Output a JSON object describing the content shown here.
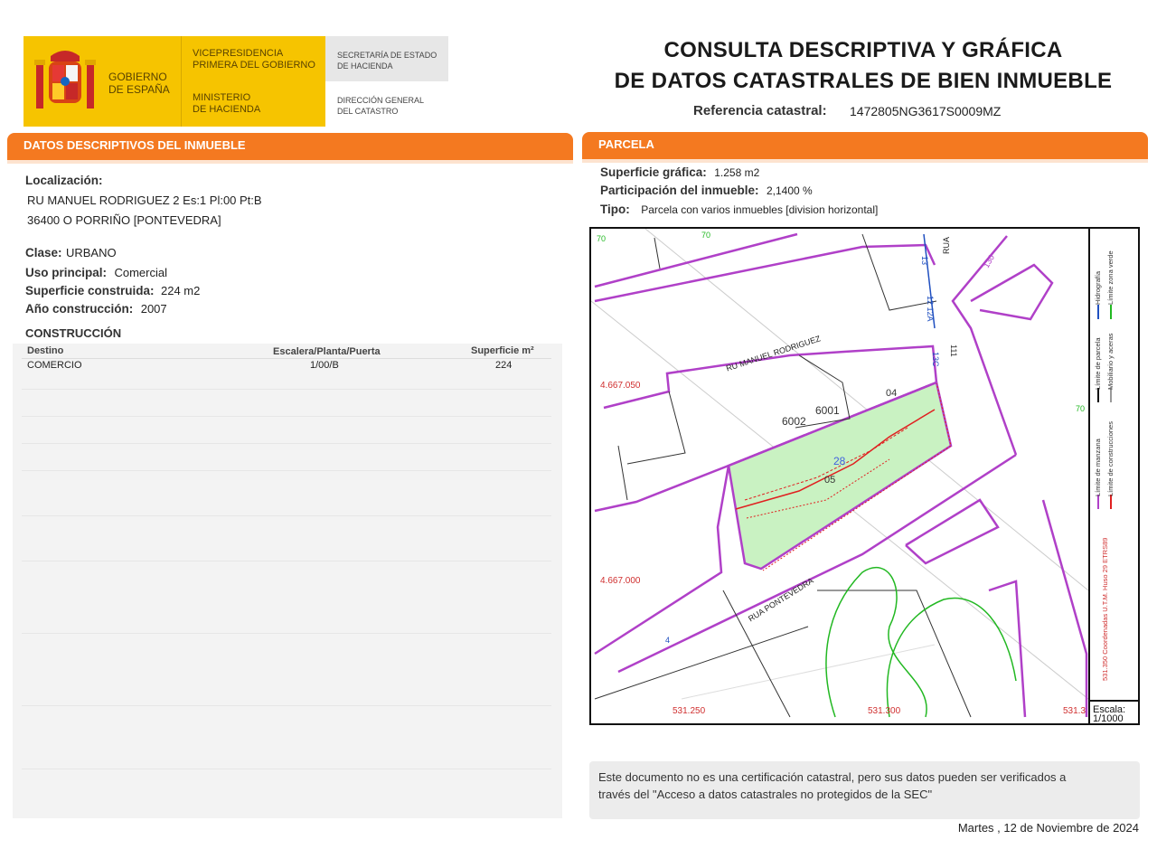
{
  "header": {
    "gobierno": [
      "GOBIERNO",
      "DE ESPAÑA"
    ],
    "vicepresidencia": [
      "VICEPRESIDENCIA",
      "PRIMERA DEL GOBIERNO"
    ],
    "ministerio": [
      "MINISTERIO",
      "DE HACIENDA"
    ],
    "secretaria": [
      "SECRETARÍA DE ESTADO",
      "DE HACIENDA"
    ],
    "direccion": [
      "DIRECCIÓN GENERAL",
      "DEL CATASTRO"
    ],
    "title_line1": "CONSULTA DESCRIPTIVA Y GRÁFICA",
    "title_line2": "DE DATOS CATASTRALES DE BIEN INMUEBLE",
    "ref_label": "Referencia catastral:",
    "ref_value": "1472805NG3617S0009MZ"
  },
  "datos": {
    "heading": "DATOS DESCRIPTIVOS DEL INMUEBLE",
    "localizacion_label": "Localización:",
    "address_line1": "RU MANUEL RODRIGUEZ 2 Es:1 Pl:00 Pt:B",
    "address_line2": "36400 O PORRIÑO [PONTEVEDRA]",
    "clase_label": "Clase:",
    "clase_value": "URBANO",
    "uso_label": "Uso principal:",
    "uso_value": "Comercial",
    "superficie_label": "Superficie construida:",
    "superficie_value": "224 m2",
    "anio_label": "Año construcción:",
    "anio_value": "2007"
  },
  "construccion": {
    "heading": "CONSTRUCCIÓN",
    "columns": [
      "Destino",
      "Escalera/Planta/Puerta",
      "Superficie m²"
    ],
    "rows": [
      {
        "destino": "COMERCIO",
        "planta": "1/00/B",
        "superficie": "224"
      }
    ]
  },
  "parcela": {
    "heading": "PARCELA",
    "superficie_label": "Superficie gráfica:",
    "superficie_value": "1.258 m2",
    "participacion_label": "Participación del inmueble:",
    "participacion_value": "2,1400 %",
    "tipo_label": "Tipo:",
    "tipo_value": "Parcela con varios inmuebles [division horizontal]"
  },
  "map": {
    "coord_y1": "4.667.050",
    "coord_y2": "4.667.000",
    "coord_x1": "531.250",
    "coord_x2": "531.300",
    "coord_x3": "531.3",
    "street1": "RU MANUEL RODRIGUEZ",
    "street2": "RUA PONTEVEDRA",
    "street3": "RUA",
    "parcel_ids": [
      "6001",
      "6002",
      "04",
      "05",
      "28",
      "111",
      "13C",
      "12 12A",
      "130",
      "13",
      "4",
      "70",
      "70",
      "70"
    ],
    "legend_col1": [
      "Límite de manzana",
      "Límite de parcela"
    ],
    "legend_col2": [
      "Límite de construcciones",
      "Mobiliario y aceras",
      "Hidrografía",
      "Límite zona verde"
    ],
    "coordinates_note": "531.350 Coordenadas U.T.M. Huso 29 ETRS89",
    "escala_label": "Escala:",
    "escala_value": "1/1000",
    "colors": {
      "parcel_fill": "#c9f2c2",
      "boundary": "#b040c8",
      "construction": "#e02020",
      "green_zone": "#22b822"
    }
  },
  "footer": {
    "note_line1": "Este documento no es una certificación catastral, pero sus datos pueden ser verificados a",
    "note_line2": "través del \"Acceso a datos catastrales no protegidos de la SEC\"",
    "date": "Martes , 12 de Noviembre de 2024"
  }
}
